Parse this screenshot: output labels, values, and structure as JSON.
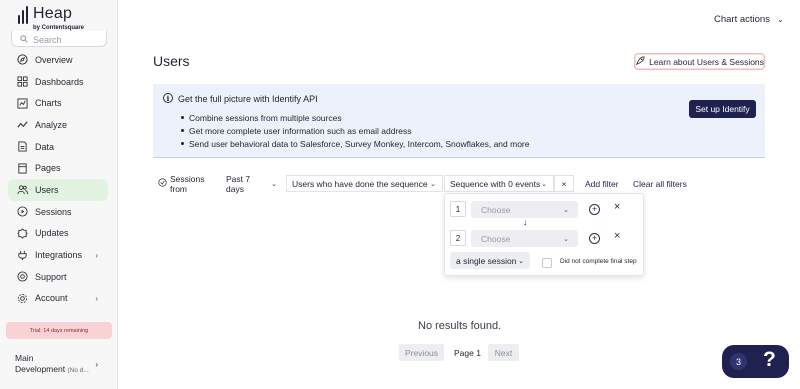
{
  "brand": {
    "name": "Heap",
    "sub": "by Contentsquare"
  },
  "sidebar": {
    "search_placeholder": "Search",
    "items": [
      {
        "label": "Overview",
        "icon": "compass-icon",
        "active": false
      },
      {
        "label": "Dashboards",
        "icon": "dashboard-icon",
        "active": false
      },
      {
        "label": "Charts",
        "icon": "chart-icon",
        "active": false
      },
      {
        "label": "Analyze",
        "icon": "trend-icon",
        "active": false
      },
      {
        "label": "Data",
        "icon": "database-icon",
        "active": false
      },
      {
        "label": "Pages",
        "icon": "page-icon",
        "active": false
      },
      {
        "label": "Users",
        "icon": "users-icon",
        "active": true
      },
      {
        "label": "Sessions",
        "icon": "play-icon",
        "active": false
      },
      {
        "label": "Updates",
        "icon": "badge-icon",
        "active": false
      },
      {
        "label": "Integrations",
        "icon": "plug-icon",
        "active": false,
        "has_chevron": true
      },
      {
        "label": "Support",
        "icon": "support-icon",
        "active": false
      },
      {
        "label": "Account",
        "icon": "gear-icon",
        "active": false,
        "has_chevron": true
      }
    ],
    "trial": "Trial: 14 days remaining",
    "env": {
      "project": "Main",
      "environment": "Development",
      "note": "(No d..."
    }
  },
  "header": {
    "chart_actions": "Chart actions",
    "title": "Users",
    "learn_button": "Learn about Users & Sessions"
  },
  "banner": {
    "title": "Get the full picture with Identify API",
    "bullets": [
      "Combine sessions from multiple sources",
      "Get more complete user information such as email address",
      "Send user behavioral data to Salesforce, Survey Monkey, Intercom, Snowflakes, and more"
    ],
    "cta": "Set up Identify"
  },
  "filters": {
    "sessions_from": "Sessions from",
    "range": "Past 7 days",
    "condition": "Users who have done the sequence",
    "sequence": "Sequence with 0 events",
    "clear_x": "×",
    "add_filter": "Add filter",
    "clear_all": "Clear all filters"
  },
  "popup": {
    "steps": [
      {
        "num": "1",
        "placeholder": "Choose"
      },
      {
        "num": "2",
        "placeholder": "Choose"
      }
    ],
    "scope": "a single session",
    "did_not_complete": "Did not complete final step",
    "did_not_complete_checked": false
  },
  "results": {
    "empty": "No results found.",
    "previous": "Previous",
    "page": "Page 1",
    "next": "Next"
  },
  "help_widget": {
    "count": "3",
    "symbol": "?"
  },
  "colors": {
    "primary": "#1f2150",
    "active_nav": "#e3f3e1",
    "banner_bg": "#edf1fb",
    "trial_bg": "#f9d2d5"
  }
}
